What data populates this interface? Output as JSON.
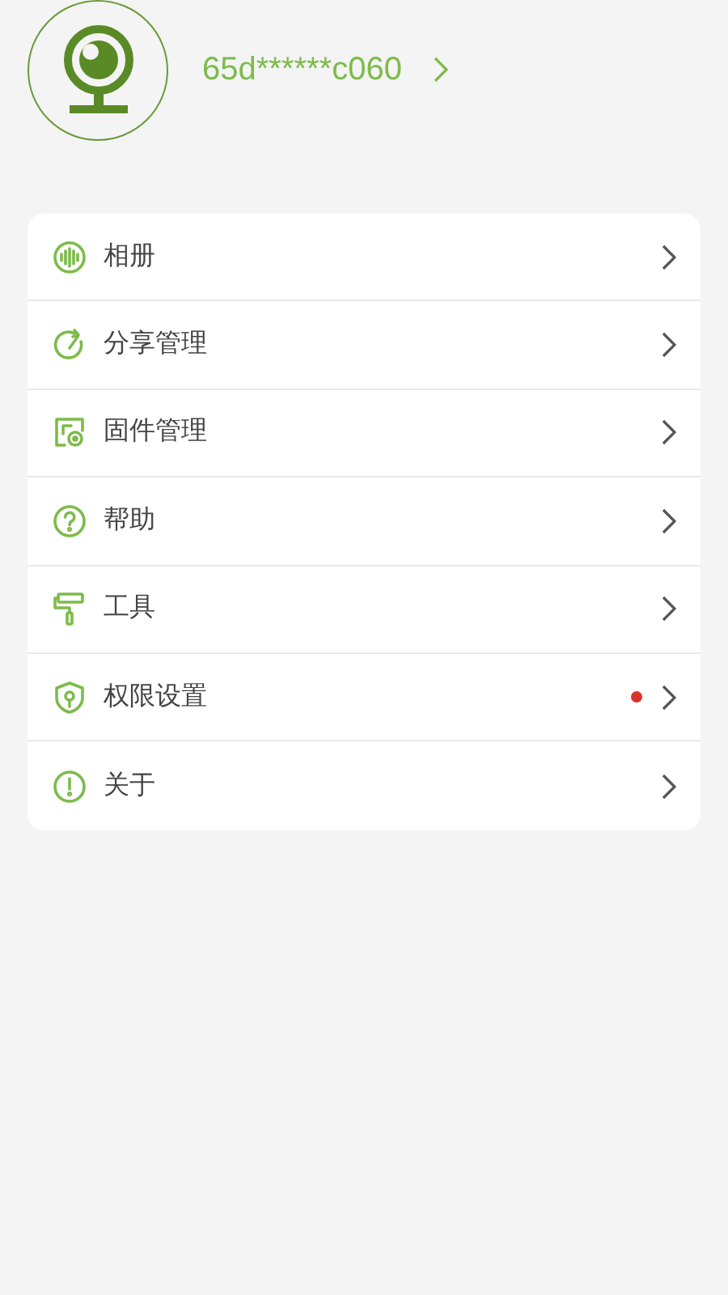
{
  "profile": {
    "device_name": "65d******c060"
  },
  "menu": [
    {
      "label": "相册",
      "dot": false
    },
    {
      "label": "分享管理",
      "dot": false
    },
    {
      "label": "固件管理",
      "dot": false
    },
    {
      "label": "帮助",
      "dot": false
    },
    {
      "label": "工具",
      "dot": false
    },
    {
      "label": "权限设置",
      "dot": true
    },
    {
      "label": "关于",
      "dot": false
    }
  ]
}
